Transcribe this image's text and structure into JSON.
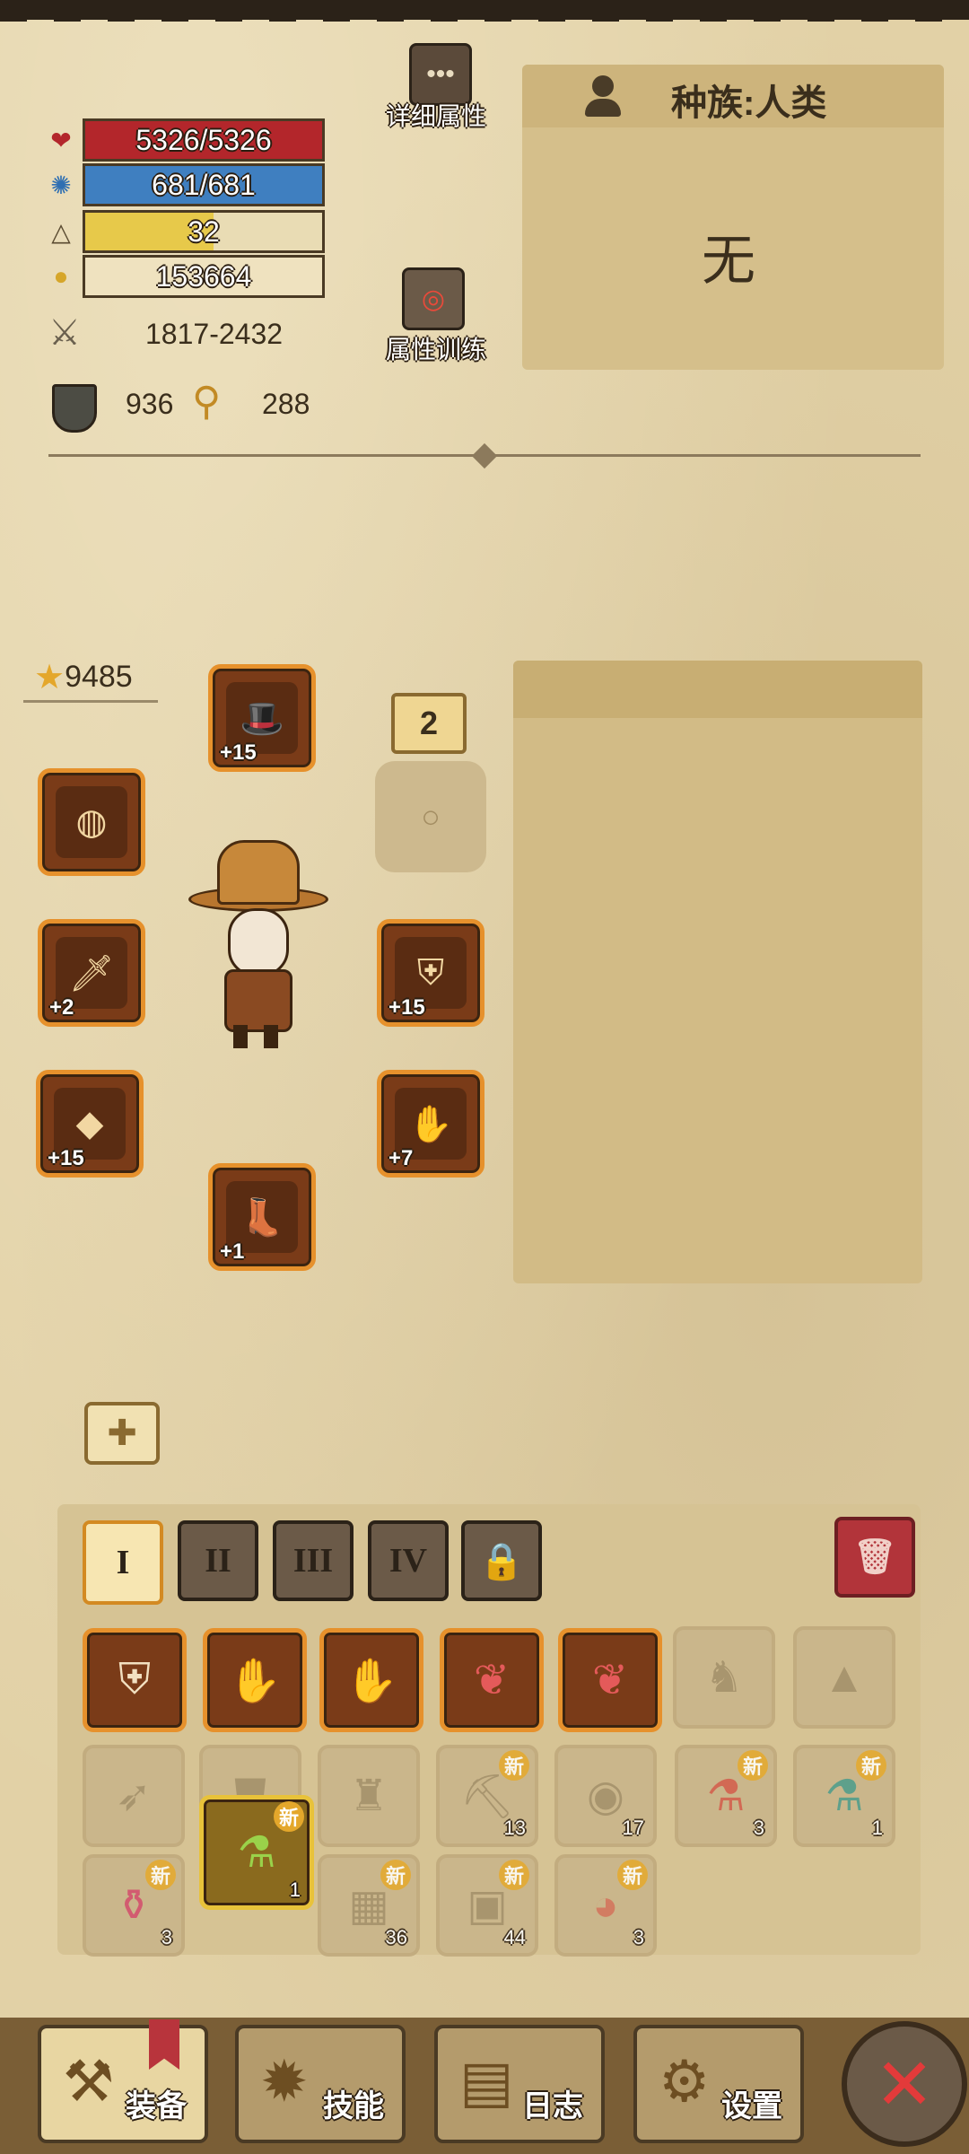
{
  "stats": {
    "hp": "5326/5326",
    "mp": "681/681",
    "level": "32",
    "gold": "153664",
    "attack": "1817-2432",
    "defense": "936",
    "magic": "288"
  },
  "buttons": {
    "detail_attrs": "详细属性",
    "attr_training": "属性训练"
  },
  "race": {
    "label": "种族:人类",
    "value": "无"
  },
  "equipment": {
    "rating": "9485",
    "slot_count": "2",
    "slots": [
      {
        "name": "hat",
        "plus": "+15"
      },
      {
        "name": "bracelet",
        "plus": ""
      },
      {
        "name": "sword",
        "plus": "+2"
      },
      {
        "name": "armor",
        "plus": "+15"
      },
      {
        "name": "amulet",
        "plus": "+15"
      },
      {
        "name": "gloves",
        "plus": "+7"
      },
      {
        "name": "boots",
        "plus": "+1"
      }
    ]
  },
  "tabs": [
    "I",
    "II",
    "III",
    "IV"
  ],
  "inventory": [
    {
      "count": "",
      "new": ""
    },
    {
      "count": "",
      "new": ""
    },
    {
      "count": "",
      "new": ""
    },
    {
      "count": "",
      "new": ""
    },
    {
      "count": "",
      "new": ""
    },
    {
      "count": "",
      "new": ""
    },
    {
      "count": "",
      "new": ""
    },
    {
      "count": "",
      "new": ""
    },
    {
      "count": "",
      "new": ""
    },
    {
      "count": "",
      "new": ""
    },
    {
      "count": "13",
      "new": "新"
    },
    {
      "count": "17",
      "new": ""
    },
    {
      "count": "3",
      "new": "新"
    },
    {
      "count": "1",
      "new": "新"
    },
    {
      "count": "3",
      "new": "新"
    },
    {
      "count": "1",
      "new": "新"
    },
    {
      "count": "36",
      "new": "新"
    },
    {
      "count": "44",
      "new": "新"
    },
    {
      "count": "3",
      "new": "新"
    }
  ],
  "nav": {
    "equip": "装备",
    "skills": "技能",
    "log": "日志",
    "settings": "设置"
  },
  "icons": {
    "close": "✕"
  }
}
